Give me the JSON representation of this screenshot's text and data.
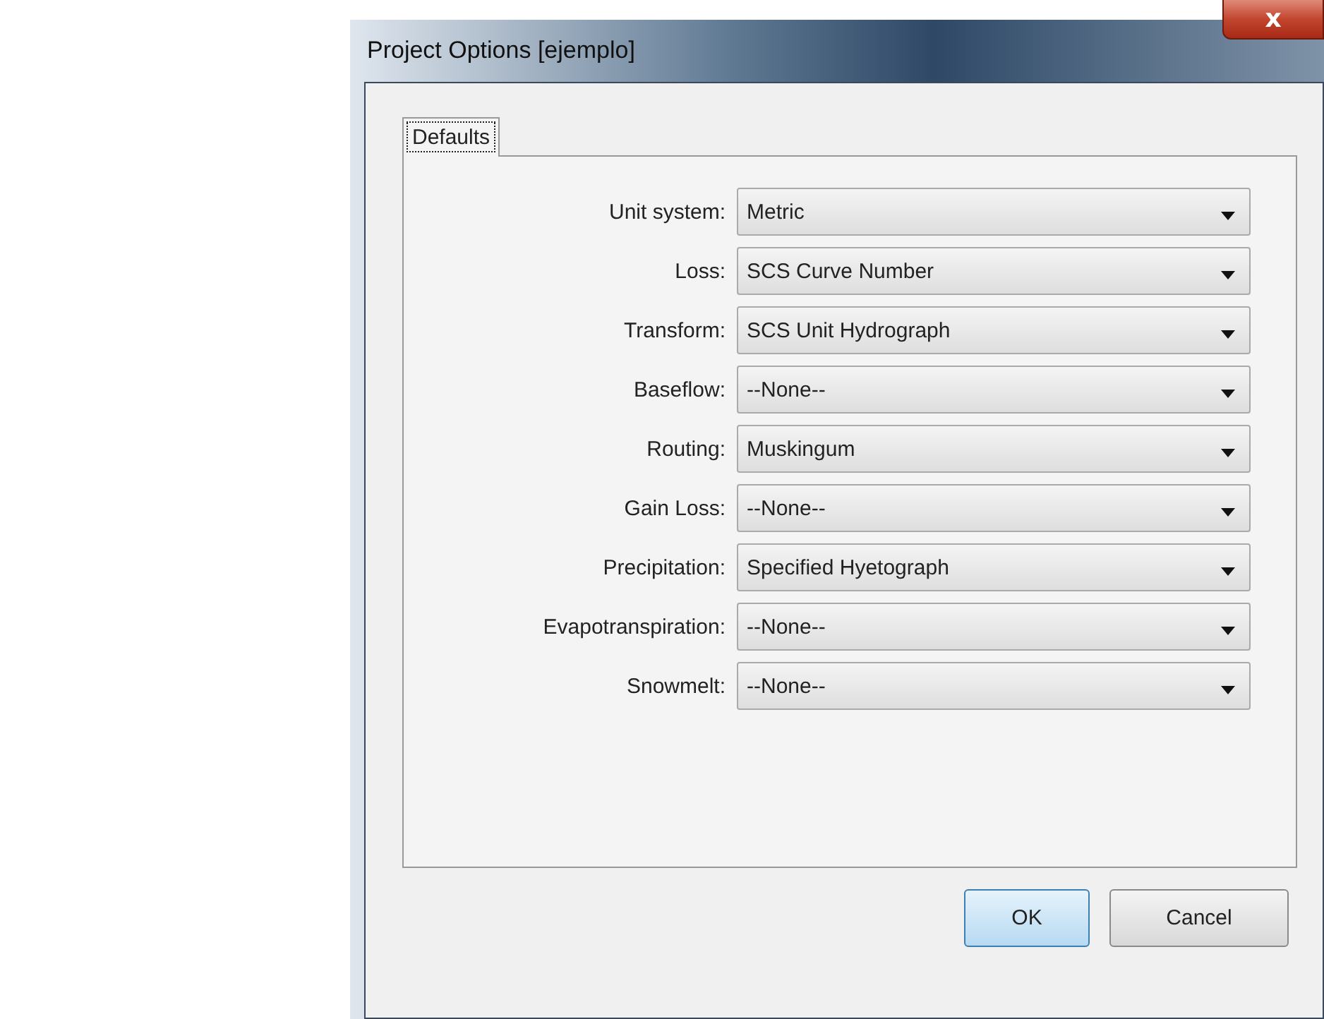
{
  "window": {
    "title": "Project Options [ejemplo]",
    "close_label": "x"
  },
  "tabs": [
    {
      "label": "Defaults",
      "selected": true
    }
  ],
  "fields": [
    {
      "label": "Unit system:",
      "value": "Metric"
    },
    {
      "label": "Loss:",
      "value": "SCS Curve Number"
    },
    {
      "label": "Transform:",
      "value": "SCS Unit Hydrograph"
    },
    {
      "label": "Baseflow:",
      "value": "--None--"
    },
    {
      "label": "Routing:",
      "value": "Muskingum"
    },
    {
      "label": "Gain Loss:",
      "value": "--None--"
    },
    {
      "label": "Precipitation:",
      "value": "Specified Hyetograph"
    },
    {
      "label": "Evapotranspiration:",
      "value": "--None--"
    },
    {
      "label": "Snowmelt:",
      "value": "--None--"
    }
  ],
  "buttons": [
    {
      "label": "OK",
      "default": true
    },
    {
      "label": "Cancel",
      "default": false
    }
  ]
}
